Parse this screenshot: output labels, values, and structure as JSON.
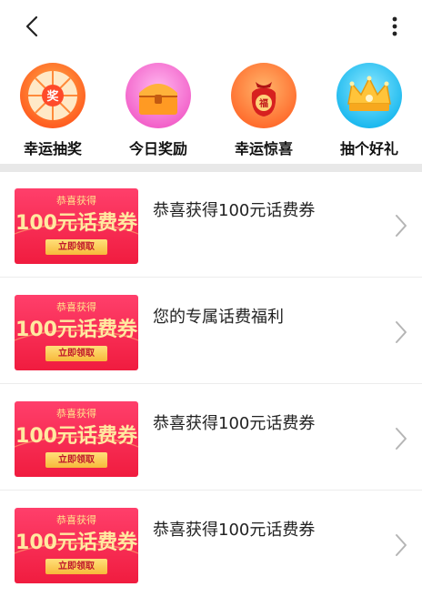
{
  "header": {
    "back_icon": "chevron-left-icon",
    "more_icon": "vertical-dots-icon"
  },
  "entries": [
    {
      "label": "幸运抽奖",
      "icon": "prize-wheel-icon",
      "color": "#ff6a2b"
    },
    {
      "label": "今日奖励",
      "icon": "treasure-chest-icon",
      "color": "#ff6fd1"
    },
    {
      "label": "幸运惊喜",
      "icon": "lucky-bag-icon",
      "color": "#ff6a36"
    },
    {
      "label": "抽个好礼",
      "icon": "crown-icon",
      "color": "#2ec6f2"
    }
  ],
  "wheel_char": "奖",
  "bag_char": "福",
  "coupon": {
    "top": "恭喜获得",
    "main": "100元话费券",
    "button": "立即领取"
  },
  "list": [
    {
      "title": "恭喜获得100元话费券"
    },
    {
      "title": "您的专属话费福利"
    },
    {
      "title": "恭喜获得100元话费券"
    },
    {
      "title": "恭喜获得100元话费券"
    }
  ]
}
